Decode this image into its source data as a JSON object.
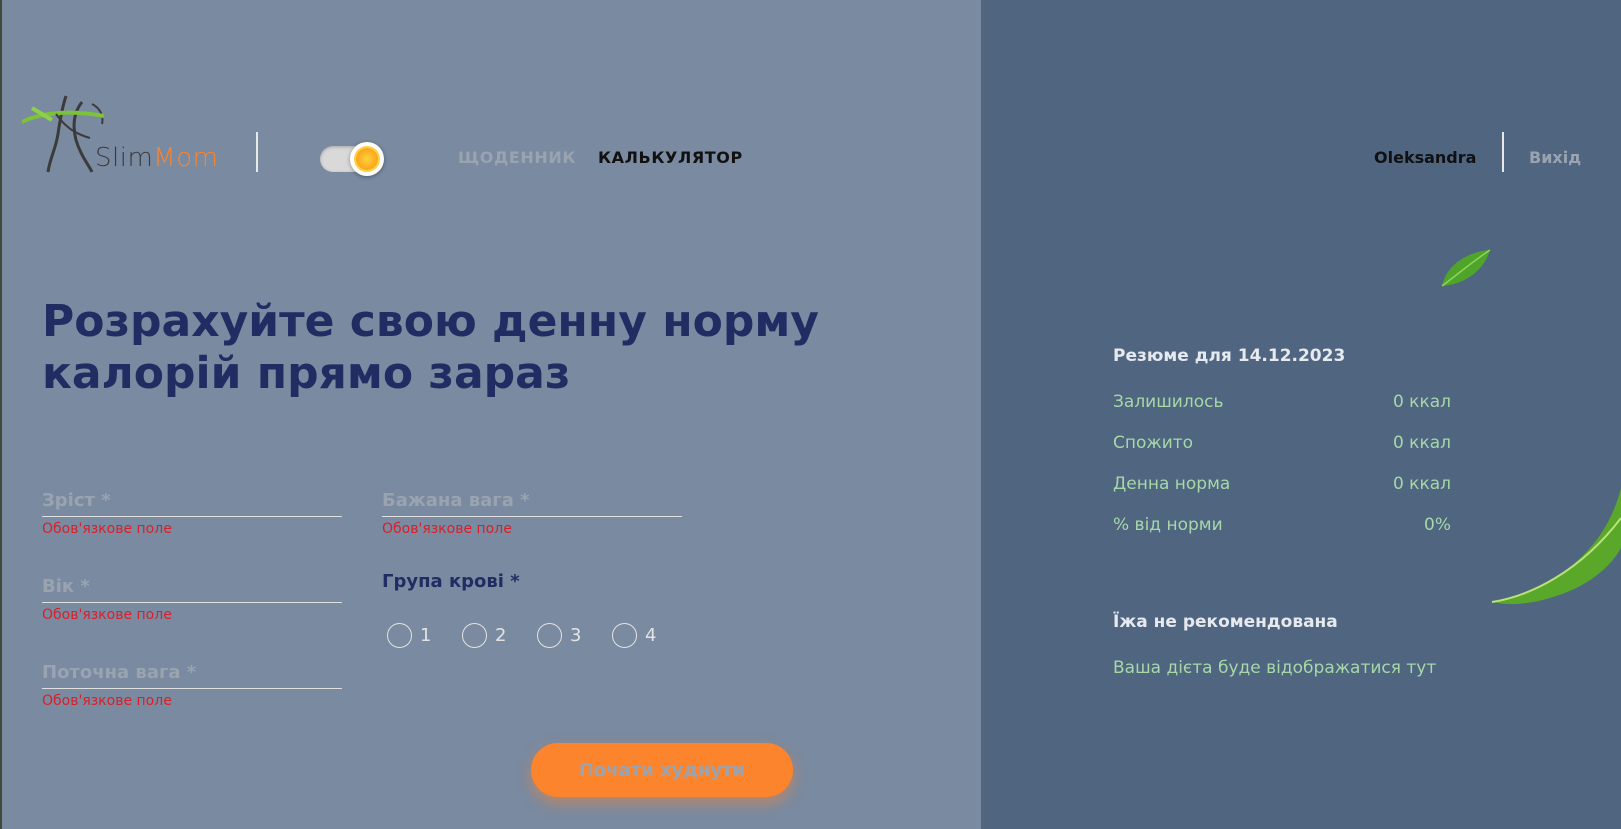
{
  "header": {
    "logo": {
      "slim": "Slim",
      "mom": "Mom"
    },
    "theme_toggle": {
      "state": "light",
      "icon": "sun-icon"
    },
    "nav": {
      "diary": "ЩОДЕННИК",
      "calculator": "КАЛЬКУЛЯТОР"
    },
    "user": {
      "name": "Oleksandra",
      "logout": "Вихід"
    }
  },
  "main": {
    "title_line1": "Розрахуйте свою денну норму",
    "title_line2": "калорій прямо зараз",
    "fields": {
      "height": {
        "label": "Зріст *",
        "error": "Обов'язкове поле"
      },
      "age": {
        "label": "Вік *",
        "error": "Обов'язкове поле"
      },
      "current_weight": {
        "label": "Поточна вага *",
        "error": "Обов'язкове поле"
      },
      "desired_weight": {
        "label": "Бажана вага *",
        "error": "Обов'язкове поле"
      }
    },
    "blood_group": {
      "label": "Група крові *",
      "options": [
        "1",
        "2",
        "3",
        "4"
      ]
    },
    "submit_label": "Почати худнути"
  },
  "summary": {
    "title": "Резюме для 14.12.2023",
    "rows": [
      {
        "label": "Залишилось",
        "value": "0 ккал"
      },
      {
        "label": "Спожито",
        "value": "0 ккал"
      },
      {
        "label": "Денна норма",
        "value": "0 ккал"
      },
      {
        "label": "% від норми",
        "value": "0%"
      }
    ],
    "food_title": "Їжа не рекомендована",
    "food_text": "Ваша дієта буде відображатися тут"
  },
  "colors": {
    "accent": "#fc842d",
    "title": "#212c63",
    "error": "#d9202a",
    "summary_value": "#a6d8a8",
    "left_bg": "#7a8aa0",
    "right_bg": "#4f6580"
  }
}
